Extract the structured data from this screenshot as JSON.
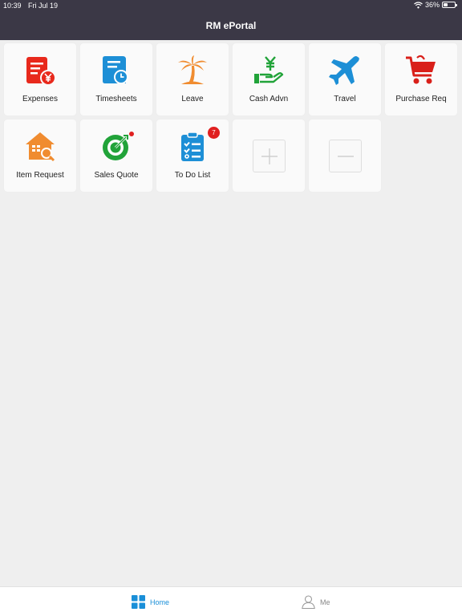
{
  "status": {
    "time": "10:39",
    "date": "Fri Jul 19",
    "battery_text": "36%",
    "battery_level": 0.36
  },
  "header": {
    "title": "RM ePortal"
  },
  "tiles": [
    {
      "label": "Expenses",
      "icon": "expense-receipt-icon",
      "color": "#e8291c"
    },
    {
      "label": "Timesheets",
      "icon": "timesheet-clock-icon",
      "color": "#1d8fd6"
    },
    {
      "label": "Leave",
      "icon": "palm-tree-icon",
      "color": "#f08c30"
    },
    {
      "label": "Cash Advn",
      "icon": "cash-hand-icon",
      "color": "#21a339"
    },
    {
      "label": "Travel",
      "icon": "airplane-icon",
      "color": "#1d8fd6"
    },
    {
      "label": "Purchase Req",
      "icon": "shopping-cart-icon",
      "color": "#d9201a"
    },
    {
      "label": "Item Request",
      "icon": "house-search-icon",
      "color": "#f08c30"
    },
    {
      "label": "Sales Quote",
      "icon": "target-icon",
      "color": "#21a339"
    },
    {
      "label": "To Do List",
      "icon": "clipboard-checklist-icon",
      "color": "#1d8fd6",
      "badge": "7"
    }
  ],
  "edit_tiles": [
    {
      "action": "add",
      "icon": "plus-icon"
    },
    {
      "action": "remove",
      "icon": "minus-icon"
    }
  ],
  "tabbar": {
    "home_label": "Home",
    "me_label": "Me",
    "active_color": "#1a8fd8"
  }
}
